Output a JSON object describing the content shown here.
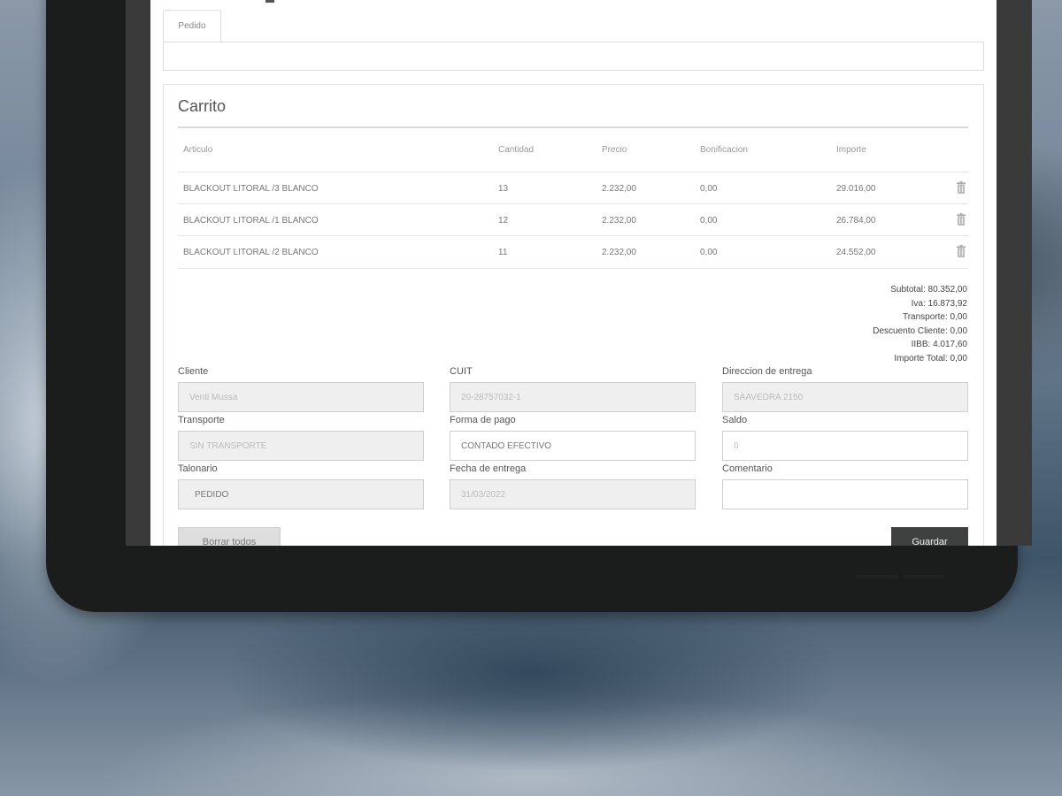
{
  "tabs": [
    {
      "label": "Pedido"
    }
  ],
  "cart": {
    "title": "Carrito",
    "headers": [
      "Articulo",
      "Cantidad",
      "Precio",
      "Bonificacion",
      "Importe"
    ],
    "rows": [
      {
        "articulo": "BLACKOUT LITORAL /3 BLANCO",
        "cantidad": "13",
        "precio": "2.232,00",
        "bonificacion": "0,00",
        "importe": "29.016,00"
      },
      {
        "articulo": "BLACKOUT LITORAL /1 BLANCO",
        "cantidad": "12",
        "precio": "2.232,00",
        "bonificacion": "0,00",
        "importe": "26.784,00"
      },
      {
        "articulo": "BLACKOUT LITORAL /2 BLANCO",
        "cantidad": "11",
        "precio": "2.232,00",
        "bonificacion": "0,00",
        "importe": "24.552,00"
      }
    ],
    "totals": {
      "subtotal": "Subtotal: 80.352,00",
      "iva": "Iva: 16.873,92",
      "transporte": "Transporte: 0,00",
      "descuento": "Descuento Cliente: 0,00",
      "iibb": "IIBB: 4.017,60",
      "importe_total": "Importe Total: 0,00"
    }
  },
  "form": {
    "cliente": {
      "label": "Cliente",
      "value": "Venti Mussa"
    },
    "cuit": {
      "label": "CUIT",
      "value": "20-28757032-1"
    },
    "direccion": {
      "label": "Direccion de entrega",
      "value": "SAAVEDRA 2150"
    },
    "transporte": {
      "label": "Transporte",
      "value": "SIN TRANSPORTE"
    },
    "forma_pago": {
      "label": "Forma de pago",
      "value": "CONTADO EFECTIVO"
    },
    "saldo": {
      "label": "Saldo",
      "value": "0"
    },
    "talonario": {
      "label": "Talonario",
      "value": "PEDIDO"
    },
    "fecha_entrega": {
      "label": "Fecha de entrega",
      "value": "31/03/2022"
    },
    "comentario": {
      "label": "Comentario",
      "value": ""
    }
  },
  "buttons": {
    "clear": "Borrar todos",
    "save": "Guardar"
  },
  "colors": {
    "save_button": "#3f4141",
    "tablet_frame": "#1b1d1d"
  },
  "icons": {
    "row_action": "trash-icon"
  }
}
